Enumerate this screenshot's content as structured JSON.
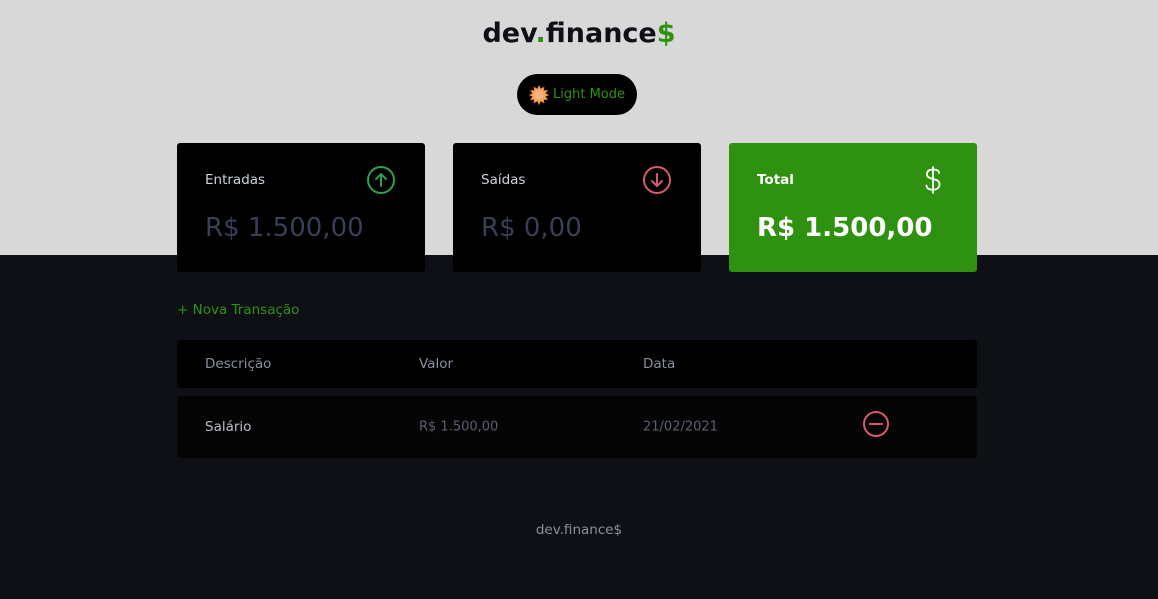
{
  "header": {
    "logo_part1": "dev",
    "logo_dot": ".",
    "logo_part2": "finance",
    "logo_dollar": "$",
    "mode_toggle_label": "Light Mode",
    "mode_icon": "sun-icon"
  },
  "summary": {
    "income": {
      "label": "Entradas",
      "value": "R$ 1.500,00",
      "icon": "arrow-up-circle-icon"
    },
    "expense": {
      "label": "Saídas",
      "value": "R$ 0,00",
      "icon": "arrow-down-circle-icon"
    },
    "total": {
      "label": "Total",
      "value": "R$ 1.500,00",
      "icon": "dollar-icon"
    }
  },
  "actions": {
    "new_transaction": "+ Nova Transação"
  },
  "table": {
    "columns": [
      "Descrição",
      "Valor",
      "Data"
    ],
    "rows": [
      {
        "description": "Salário",
        "amount": "R$ 1.500,00",
        "date": "21/02/2021",
        "remove_icon": "minus-circle-icon"
      }
    ]
  },
  "footer": {
    "text": "dev.finance$"
  },
  "colors": {
    "brand_green": "#2e9210",
    "income_icon": "#2e9e55",
    "expense_icon": "#d9586a",
    "dark_bg": "#0f1016",
    "light_bg": "#d8d8d8"
  }
}
